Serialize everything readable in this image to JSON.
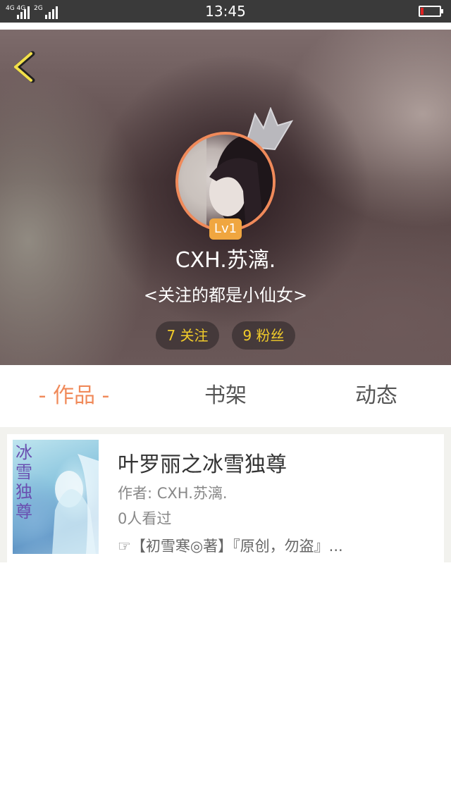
{
  "status_bar": {
    "network1": "4G 4G",
    "network2": "2G",
    "time": "13:45",
    "battery_icon": "battery-low-icon",
    "battery_level": 0.15,
    "battery_color": "#e02020"
  },
  "header": {
    "back_icon": "chevron-left-icon",
    "level": "Lv1",
    "username": "CXH.苏漓.",
    "bio": "<关注的都是小仙女>",
    "following": "7 关注",
    "fans": "9 粉丝",
    "accent_color": "#f08a5a",
    "stat_color": "#f2cc2a"
  },
  "tabs": {
    "works": "- 作品 -",
    "shelf": "书架",
    "feed": "动态",
    "active": "works"
  },
  "book": {
    "cover_title": "冰雪独尊",
    "title": "叶罗丽之冰雪独尊",
    "author": "作者: CXH.苏漓.",
    "views": "0人看过",
    "description": "☞【初雪寒◎著】『原创，勿盗』..."
  }
}
